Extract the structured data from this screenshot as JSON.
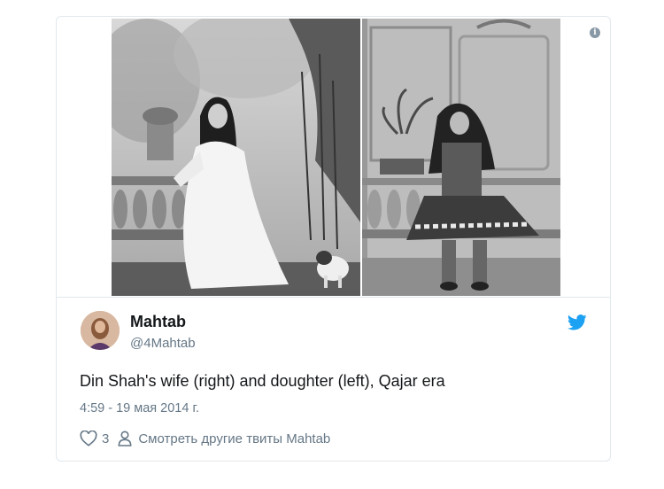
{
  "tweet": {
    "author_name": "Mahtab",
    "author_handle": "@4Mahtab",
    "text": "Din Shah's wife (right) and doughter (left), Qajar era",
    "timestamp": "4:59 - 19 мая 2014 г.",
    "like_count": "3",
    "view_more_label": "Смотреть другие твиты Mahtab",
    "info_icon": "i"
  },
  "icons": {
    "info": "info-icon",
    "bird": "twitter-bird-icon",
    "heart": "heart-icon",
    "person": "person-icon"
  },
  "colors": {
    "brand": "#1da1f2",
    "secondary_text": "#657786",
    "border": "#e1e8ed"
  }
}
